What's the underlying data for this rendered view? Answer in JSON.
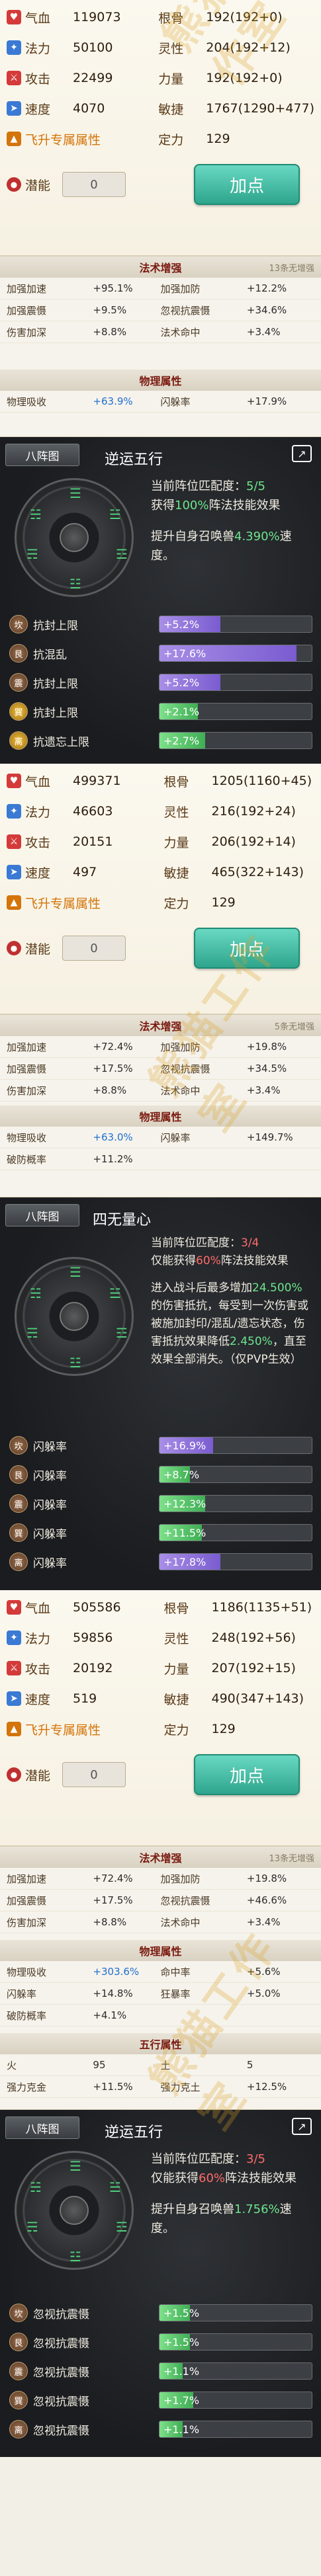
{
  "stats1": {
    "hp": {
      "label": "气血",
      "value": "119073"
    },
    "gen": {
      "label": "根骨",
      "value": "192(192+0)"
    },
    "mp": {
      "label": "法力",
      "value": "50100"
    },
    "ling": {
      "label": "灵性",
      "value": "204(192+12)"
    },
    "atk": {
      "label": "攻击",
      "value": "22499"
    },
    "str": {
      "label": "力量",
      "value": "192(192+0)"
    },
    "spd": {
      "label": "速度",
      "value": "4070"
    },
    "agi": {
      "label": "敏捷",
      "value": "1767(1290+477)"
    },
    "fly": {
      "label": "飞升专属属性"
    },
    "ding": {
      "label": "定力",
      "value": "129"
    },
    "pot": {
      "label": "潜能",
      "value": "0"
    },
    "add": "加点"
  },
  "res1": {
    "head": "法术增强",
    "head_right": "13条无增强",
    "rows": [
      [
        "加强加速",
        "+95.1%",
        "加强加防",
        "+12.2%"
      ],
      [
        "加强震慑",
        "+9.5%",
        "忽视抗震慑",
        "+34.6%"
      ],
      [
        "伤害加深",
        "+8.8%",
        "法术命中",
        "+3.4%"
      ]
    ],
    "head2": "物理属性",
    "rows2": [
      [
        "物理吸收",
        "+63.9%",
        "闪躲率",
        "+17.9%"
      ]
    ]
  },
  "form1": {
    "tab": "八阵图",
    "name": "逆运五行",
    "l1a": "当前阵位匹配度：",
    "l1b": "5/5",
    "l2a": "获得",
    "l2b": "100%",
    "l2c": "阵法技能效果",
    "l3a": "提升自身召唤兽",
    "l3b": "4.390%",
    "l3c": "速度。",
    "rows": [
      {
        "orb": "坎",
        "name": "抗封上限",
        "bar": "+5.2%",
        "fill": 0.4,
        "green": false
      },
      {
        "orb": "艮",
        "name": "抗混乱",
        "bar": "+17.6%",
        "fill": 0.9,
        "green": false
      },
      {
        "orb": "震",
        "name": "抗封上限",
        "bar": "+5.2%",
        "fill": 0.4,
        "green": false
      },
      {
        "orb": "巽",
        "name": "抗封上限",
        "bar": "+2.1%",
        "fill": 0.25,
        "green": true
      },
      {
        "orb": "离",
        "name": "抗遗忘上限",
        "bar": "+2.7%",
        "fill": 0.3,
        "green": true
      }
    ]
  },
  "stats2": {
    "hp": {
      "label": "气血",
      "value": "499371"
    },
    "gen": {
      "label": "根骨",
      "value": "1205(1160+45)"
    },
    "mp": {
      "label": "法力",
      "value": "46603"
    },
    "ling": {
      "label": "灵性",
      "value": "216(192+24)"
    },
    "atk": {
      "label": "攻击",
      "value": "20151"
    },
    "str": {
      "label": "力量",
      "value": "206(192+14)"
    },
    "spd": {
      "label": "速度",
      "value": "497"
    },
    "agi": {
      "label": "敏捷",
      "value": "465(322+143)"
    },
    "fly": {
      "label": "飞升专属属性"
    },
    "ding": {
      "label": "定力",
      "value": "129"
    },
    "pot": {
      "label": "潜能",
      "value": "0"
    },
    "add": "加点"
  },
  "res2": {
    "head": "法术增强",
    "head_right": "5条无增强",
    "rows": [
      [
        "加强加速",
        "+72.4%",
        "加强加防",
        "+19.8%"
      ],
      [
        "加强震慑",
        "+17.5%",
        "忽视抗震慑",
        "+34.5%"
      ],
      [
        "伤害加深",
        "+8.8%",
        "法术命中",
        "+3.4%"
      ]
    ],
    "head2": "物理属性",
    "rows2": [
      [
        "物理吸收",
        "+63.0%",
        "闪躲率",
        "+149.7%"
      ],
      [
        "破防概率",
        "+11.2%",
        "",
        ""
      ]
    ]
  },
  "form2": {
    "tab": "八阵图",
    "name": "四无量心",
    "l1a": "当前阵位匹配度：",
    "l1b": "3/4",
    "l2a": "仅能获得",
    "l2b": "60%",
    "l2c": "阵法技能效果",
    "l3": "进入战斗后最多增加",
    "l3b": "24.500%",
    "l3c": "的伤害抵抗，每受到一次伤害或被施加封印/混乱/遗忘状态，伤害抵抗效果降低",
    "l3d": "2.450%",
    "l3e": "，直至效果全部消失。（仅PVP生效）",
    "rows": [
      {
        "orb": "坎",
        "name": "闪躲率",
        "bar": "+16.9%",
        "fill": 0.35,
        "green": false
      },
      {
        "orb": "艮",
        "name": "闪躲率",
        "bar": "+8.7%",
        "fill": 0.2,
        "green": true
      },
      {
        "orb": "震",
        "name": "闪躲率",
        "bar": "+12.3%",
        "fill": 0.3,
        "green": true
      },
      {
        "orb": "巽",
        "name": "闪躲率",
        "bar": "+11.5%",
        "fill": 0.28,
        "green": true
      },
      {
        "orb": "离",
        "name": "闪躲率",
        "bar": "+17.8%",
        "fill": 0.4,
        "green": false
      }
    ]
  },
  "stats3": {
    "hp": {
      "label": "气血",
      "value": "505586"
    },
    "gen": {
      "label": "根骨",
      "value": "1186(1135+51)"
    },
    "mp": {
      "label": "法力",
      "value": "59856"
    },
    "ling": {
      "label": "灵性",
      "value": "248(192+56)"
    },
    "atk": {
      "label": "攻击",
      "value": "20192"
    },
    "str": {
      "label": "力量",
      "value": "207(192+15)"
    },
    "spd": {
      "label": "速度",
      "value": "519"
    },
    "agi": {
      "label": "敏捷",
      "value": "490(347+143)"
    },
    "fly": {
      "label": "飞升专属属性"
    },
    "ding": {
      "label": "定力",
      "value": "129"
    },
    "pot": {
      "label": "潜能",
      "value": "0"
    },
    "add": "加点"
  },
  "res3": {
    "head": "法术增强",
    "head_right": "13条无增强",
    "rows": [
      [
        "加强加速",
        "+72.4%",
        "加强加防",
        "+19.8%"
      ],
      [
        "加强震慑",
        "+17.5%",
        "忽视抗震慑",
        "+46.6%"
      ],
      [
        "伤害加深",
        "+8.8%",
        "法术命中",
        "+3.4%"
      ]
    ],
    "head2": "物理属性",
    "rows2": [
      [
        "物理吸收",
        "+303.6%",
        "命中率",
        "+5.6%"
      ],
      [
        "闪躲率",
        "+14.8%",
        "狂暴率",
        "+5.0%"
      ],
      [
        "破防概率",
        "+4.1%",
        "",
        ""
      ]
    ],
    "head3": "五行属性",
    "rows3": [
      [
        "火",
        "95",
        "土",
        "5"
      ],
      [
        "强力克金",
        "+11.5%",
        "强力克土",
        "+12.5%"
      ]
    ]
  },
  "form3": {
    "tab": "八阵图",
    "name": "逆运五行",
    "l1a": "当前阵位匹配度：",
    "l1b": "3/5",
    "l2a": "仅能获得",
    "l2b": "60%",
    "l2c": "阵法技能效果",
    "l3a": "提升自身召唤兽",
    "l3b": "1.756%",
    "l3c": "速度。",
    "rows": [
      {
        "orb": "坎",
        "name": "忽视抗震慑",
        "bar": "+1.5%",
        "fill": 0.2,
        "green": true
      },
      {
        "orb": "艮",
        "name": "忽视抗震慑",
        "bar": "+1.5%",
        "fill": 0.2,
        "green": true
      },
      {
        "orb": "震",
        "name": "忽视抗震慑",
        "bar": "+1.1%",
        "fill": 0.15,
        "green": true
      },
      {
        "orb": "巽",
        "name": "忽视抗震慑",
        "bar": "+1.7%",
        "fill": 0.22,
        "green": true
      },
      {
        "orb": "离",
        "name": "忽视抗震慑",
        "bar": "+1.1%",
        "fill": 0.15,
        "green": true
      }
    ]
  },
  "watermark": "熊猫工作室",
  "colors": {
    "hp": "#d43a3a",
    "mp": "#3a7ad4",
    "atk": "#d43a3a",
    "spd": "#3a7ad4",
    "fly": "#d4740a",
    "pot": "#c03030",
    "accent": "#2fa58d"
  }
}
